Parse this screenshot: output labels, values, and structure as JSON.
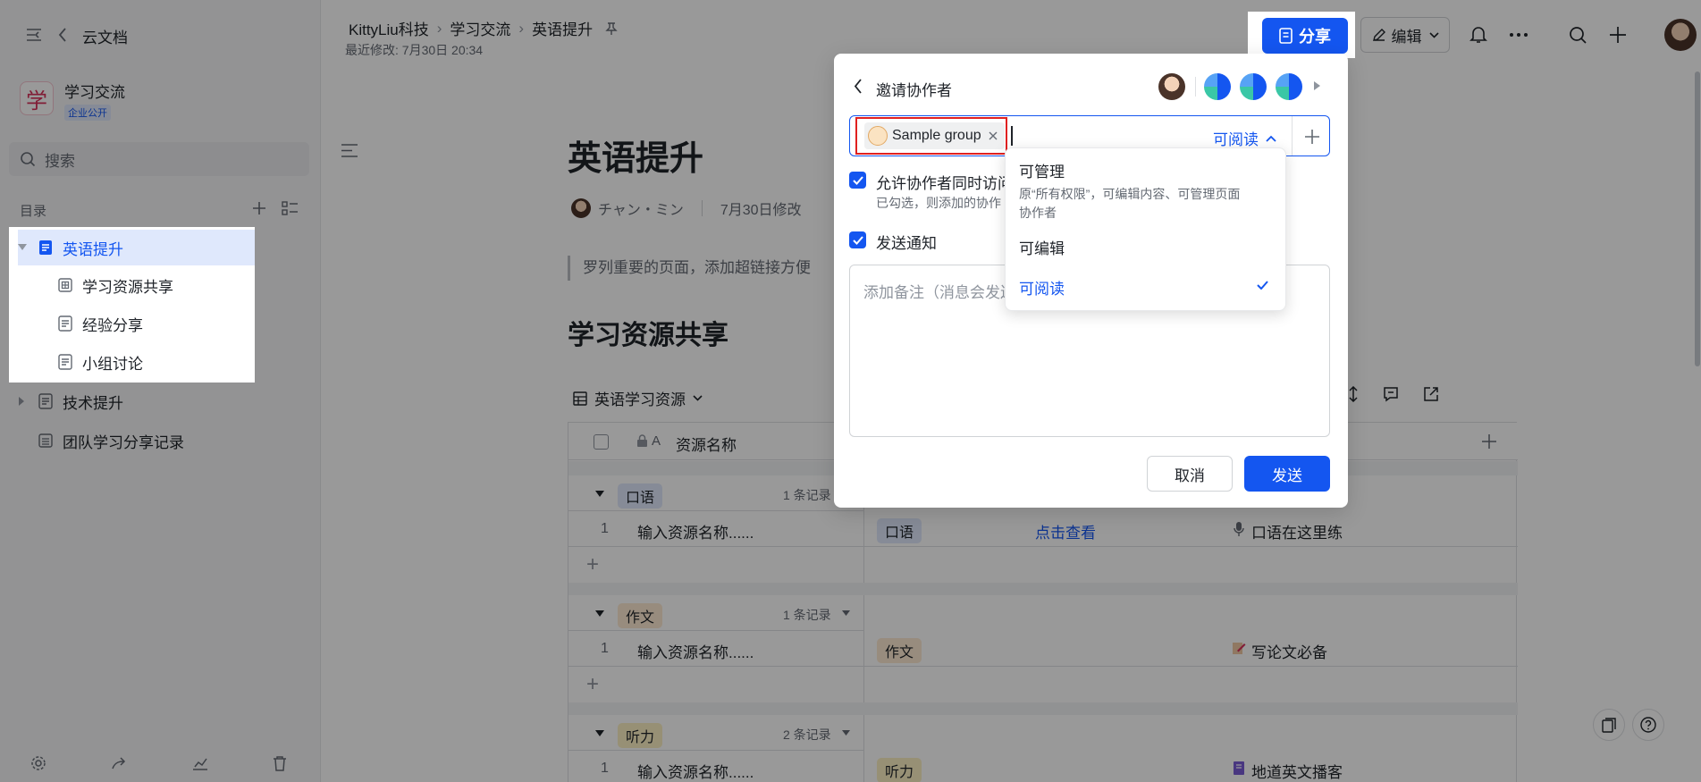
{
  "sidebar": {
    "app_title": "云文档",
    "space_name": "学习交流",
    "space_badge": "企业公开",
    "space_avatar": "学",
    "search_placeholder": "搜索",
    "toc_label": "目录",
    "tree": [
      {
        "label": "英语提升"
      },
      {
        "label": "学习资源共享"
      },
      {
        "label": "经验分享"
      },
      {
        "label": "小组讨论"
      },
      {
        "label": "技术提升"
      },
      {
        "label": "团队学习分享记录"
      }
    ]
  },
  "header": {
    "breadcrumb": [
      "KittyLiu科技",
      "学习交流",
      "英语提升"
    ],
    "last_modified": "最近修改: 7月30日 20:34",
    "share_label": "分享",
    "edit_label": "编辑"
  },
  "doc": {
    "title": "英语提升",
    "author": "チャン・ミン",
    "modified": "7月30日修改",
    "quote": "罗列重要的页面，添加超链接方便",
    "section_title": "学习资源共享",
    "table_name": "英语学习资源",
    "column_name": "资源名称",
    "groups": [
      {
        "tag": "口语",
        "count": "1 条记录",
        "row_index": "1",
        "name": "输入资源名称......",
        "cell_tag": "口语",
        "link": "点击查看",
        "note": "口语在这里练"
      },
      {
        "tag": "作文",
        "count": "1 条记录",
        "row_index": "1",
        "name": "输入资源名称......",
        "cell_tag": "作文",
        "link": "",
        "note": "写论文必备"
      },
      {
        "tag": "听力",
        "count": "2 条记录",
        "row_index": "1",
        "name": "输入资源名称......",
        "cell_tag": "听力",
        "link": "",
        "note": "地道英文播客"
      }
    ],
    "add_row": "+"
  },
  "dialog": {
    "title": "邀请协作者",
    "chip_label": "Sample group",
    "permission_value": "可阅读",
    "allow_access_label": "允许协作者同时访问",
    "allow_access_hint": "已勾选，则添加的协作",
    "notify_label": "发送通知",
    "note_placeholder": "添加备注（消息会发送",
    "cancel_label": "取消",
    "send_label": "发送"
  },
  "dropdown": {
    "options": [
      {
        "label": "可管理",
        "desc": "原“所有权限”，可编辑内容、可管理页面协作者"
      },
      {
        "label": "可编辑",
        "desc": ""
      },
      {
        "label": "可阅读",
        "desc": ""
      }
    ],
    "selected_index": 2
  },
  "colors": {
    "accent": "#1456f0",
    "highlight_border": "#e02020"
  }
}
